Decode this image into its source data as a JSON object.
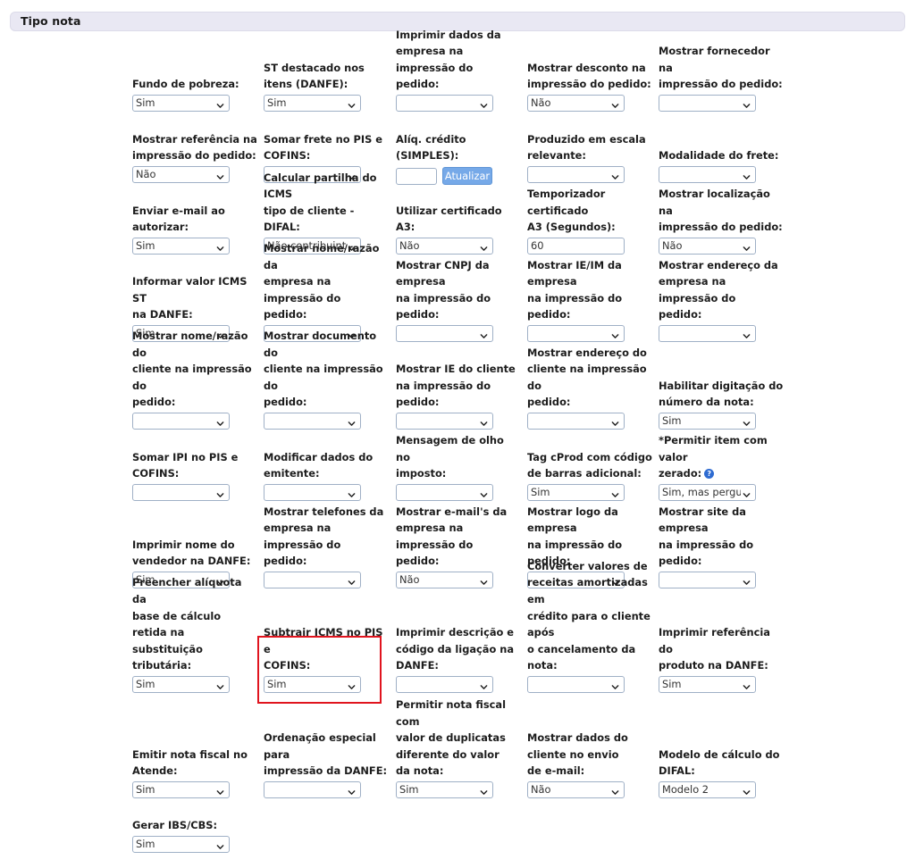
{
  "section": {
    "title": "Tipo nota"
  },
  "atualizar_label": "Atualizar",
  "rows": [
    {
      "height": 80,
      "fields": [
        {
          "label": "Fundo de pobreza:",
          "type": "select",
          "value": "Sim"
        },
        {
          "label": "ST destacado nos\nitens (DANFE):",
          "type": "select",
          "value": "Sim"
        },
        {
          "label": "Imprimir dados da\nempresa na impressão do\npedido:",
          "type": "select",
          "value": ""
        },
        {
          "label": "Mostrar desconto na\nimpressão do pedido:",
          "type": "select",
          "value": "Não"
        },
        {
          "label": "Mostrar fornecedor na\nimpressão do pedido:",
          "type": "select",
          "value": ""
        }
      ]
    },
    {
      "height": 80,
      "fields": [
        {
          "label": "Mostrar referência na\nimpressão do pedido:",
          "type": "select",
          "value": "Não"
        },
        {
          "label": "Somar frete no PIS e\nCOFINS:",
          "type": "select",
          "value": ""
        },
        {
          "label": "Alíq. crédito (SIMPLES):",
          "type": "input-button",
          "value": ""
        },
        {
          "label": "Produzido em escala\nrelevante:",
          "type": "select",
          "value": ""
        },
        {
          "label": "Modalidade do frete:",
          "type": "select",
          "value": ""
        }
      ]
    },
    {
      "height": 80,
      "fields": [
        {
          "label": "Enviar e-mail ao\nautorizar:",
          "type": "select",
          "value": "Sim"
        },
        {
          "label": "Calcular partilha do ICMS\ntipo de cliente - DIFAL:",
          "type": "select",
          "value": "Não contribuinte ("
        },
        {
          "label": "Utilizar certificado A3:",
          "type": "select",
          "value": "Não"
        },
        {
          "label": "Temporizador certificado\nA3 (Segundos):",
          "type": "text",
          "value": "60"
        },
        {
          "label": "Mostrar localização na\nimpressão do pedido:",
          "type": "select",
          "value": "Não"
        }
      ]
    },
    {
      "height": 98,
      "fields": [
        {
          "label": "Informar valor ICMS ST\nna DANFE:",
          "type": "select",
          "value": "Sim"
        },
        {
          "label": "Mostrar nome/razão da\nempresa na impressão do\npedido:",
          "type": "select",
          "value": ""
        },
        {
          "label": "Mostrar CNPJ da empresa\nna impressão do pedido:",
          "type": "select",
          "value": ""
        },
        {
          "label": "Mostrar IE/IM da empresa\nna impressão do pedido:",
          "type": "select",
          "value": ""
        },
        {
          "label": "Mostrar endereço da\nempresa na impressão do\npedido:",
          "type": "select",
          "value": ""
        }
      ]
    },
    {
      "height": 98,
      "fields": [
        {
          "label": "Mostrar nome/razão do\ncliente na impressão do\npedido:",
          "type": "select",
          "value": ""
        },
        {
          "label": "Mostrar documento do\ncliente na impressão do\npedido:",
          "type": "select",
          "value": ""
        },
        {
          "label": "Mostrar IE do cliente\nna impressão do pedido:",
          "type": "select",
          "value": ""
        },
        {
          "label": "Mostrar endereço do\ncliente na impressão do\npedido:",
          "type": "select",
          "value": ""
        },
        {
          "label": "Habilitar digitação do\nnúmero da nota:",
          "type": "select",
          "value": "Sim"
        }
      ]
    },
    {
      "height": 80,
      "fields": [
        {
          "label": "Somar IPI no PIS e\nCOFINS:",
          "type": "select",
          "value": ""
        },
        {
          "label": "Modificar dados do\nemitente:",
          "type": "select",
          "value": ""
        },
        {
          "label": "Mensagem de olho no\nimposto:",
          "type": "select",
          "value": ""
        },
        {
          "label": "Tag cProd com código\nde barras adicional:",
          "type": "select",
          "value": "Sim"
        },
        {
          "label": "*Permitir item com valor\nzerado:",
          "type": "select",
          "value": "Sim, mas pergunt",
          "help": true
        }
      ]
    },
    {
      "height": 98,
      "fields": [
        {
          "label": "Imprimir nome do\nvendedor na DANFE:",
          "type": "select",
          "value": "Sim"
        },
        {
          "label": "Mostrar telefones da\nempresa na impressão do\npedido:",
          "type": "select",
          "value": ""
        },
        {
          "label": "Mostrar e-mail's da\nempresa na impressão do\npedido:",
          "type": "select",
          "value": "Não"
        },
        {
          "label": "Mostrar logo da empresa\nna impressão do pedido:",
          "type": "select",
          "value": ""
        },
        {
          "label": "Mostrar site da empresa\nna impressão do pedido:",
          "type": "select",
          "value": ""
        }
      ]
    },
    {
      "height": 117,
      "fields": [
        {
          "label": "Preencher alíquota da\nbase de cálculo retida na\nsubstituição tributária:",
          "type": "select",
          "value": "Sim"
        },
        {
          "label": "Subtrair ICMS no PIS e\nCOFINS:",
          "type": "select",
          "value": "Sim"
        },
        {
          "label": "Imprimir descrição e\ncódigo da ligação na\nDANFE:",
          "type": "select",
          "value": ""
        },
        {
          "label": "Converter valores de\nreceitas amortizadas em\ncrédito para o cliente após\no cancelamento da nota:",
          "type": "select",
          "value": ""
        },
        {
          "label": "Imprimir referência do\nproduto na DANFE:",
          "type": "select",
          "value": "Sim"
        }
      ]
    },
    {
      "height": 118,
      "fields": [
        {
          "label": "Emitir nota fiscal no\nAtende:",
          "type": "select",
          "value": "Sim"
        },
        {
          "label": "Ordenação especial para\nimpressão da DANFE:",
          "type": "select",
          "value": ""
        },
        {
          "label": "Permitir nota fiscal com\nvalor de duplicatas\ndiferente do valor\nda nota:",
          "type": "select",
          "value": "Sim"
        },
        {
          "label": "Mostrar dados do\ncliente no envio\nde e-mail:",
          "type": "select",
          "value": "Não"
        },
        {
          "label": "Modelo de cálculo do\nDIFAL:",
          "type": "select",
          "value": "Modelo 2"
        }
      ]
    },
    {
      "height": 61,
      "fields": [
        {
          "label": "Gerar IBS/CBS:",
          "type": "select",
          "value": "Sim"
        }
      ]
    }
  ]
}
